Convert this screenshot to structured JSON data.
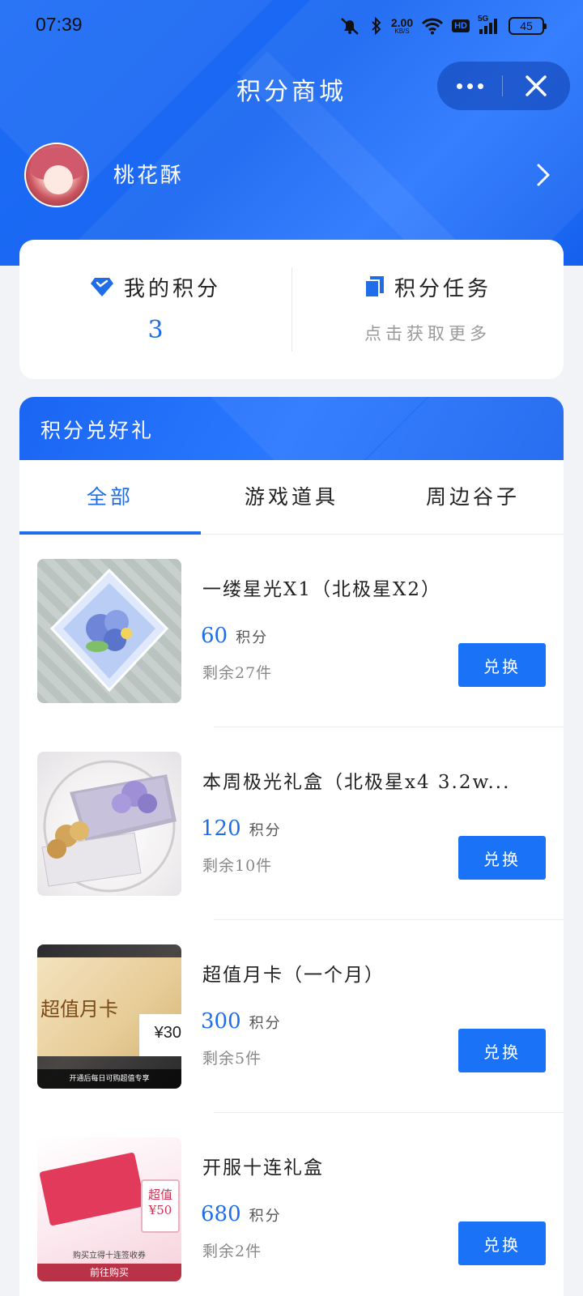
{
  "status_bar": {
    "time": "07:39",
    "net_speed": "2.00",
    "net_unit": "KB/S",
    "network": "5G",
    "hd": "HD",
    "battery": "45",
    "icons": [
      "mute-icon",
      "bluetooth-icon",
      "wifi-icon",
      "signal-icon",
      "battery-icon"
    ]
  },
  "header": {
    "title": "积分商城"
  },
  "profile": {
    "username": "桃花酥"
  },
  "points": {
    "my_points_label": "我的积分",
    "my_points_value": "3",
    "tasks_label": "积分任务",
    "tasks_sub": "点击获取更多"
  },
  "gifts": {
    "title": "积分兑好礼",
    "tabs": [
      {
        "label": "全部",
        "active": true
      },
      {
        "label": "游戏道具",
        "active": false
      },
      {
        "label": "周边谷子",
        "active": false
      }
    ],
    "unit_label": "积分",
    "redeem_label": "兑换",
    "items": [
      {
        "name": "一缕星光X1（北极星X2）",
        "price": "60",
        "stock": "剩余27件"
      },
      {
        "name": "本周极光礼盒（北极星x4 3.2w...",
        "price": "120",
        "stock": "剩余10件"
      },
      {
        "name": "超值月卡（一个月）",
        "price": "300",
        "stock": "剩余5件"
      },
      {
        "name": "开服十连礼盒",
        "price": "680",
        "stock": "剩余2件"
      }
    ],
    "thumb_text": {
      "monthly_card": "超值月卡",
      "monthly_price": "¥30",
      "monthly_promo": "开通后每日可购超值专享",
      "pink_tag": "超值",
      "pink_price": "¥50",
      "pink_caption": "购买立得十连签收券",
      "pink_button": "前往购买"
    }
  },
  "colors": {
    "brand_blue": "#1f6de8",
    "button_blue": "#1a73f7",
    "page_bg": "#f2f3f7"
  }
}
